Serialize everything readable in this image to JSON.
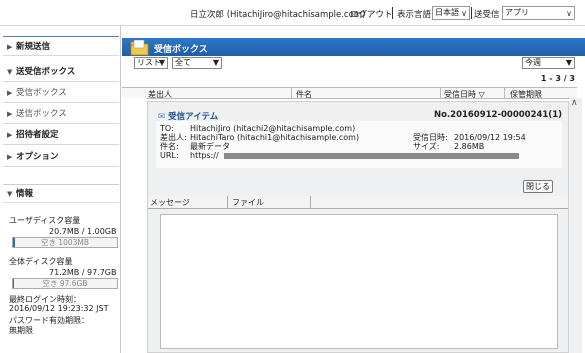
{
  "header": {
    "user": "日立次郎 (HitachiJiro@hitachisample.com)",
    "logout": "ログアウト",
    "language_label": "表示言語",
    "language_value": "日本語",
    "destination_label": "送受信",
    "destination_value": "アプリ"
  },
  "sidebar": {
    "items": [
      {
        "label": "新規送信"
      },
      {
        "label": "送受信ボックス"
      },
      {
        "label": "受信ボックス"
      },
      {
        "label": "送信ボックス"
      },
      {
        "label": "招待者設定"
      },
      {
        "label": "オプション"
      }
    ],
    "info": {
      "title": "情報",
      "user_disk_label": "ユーザディスク容量",
      "user_disk_usage": "20.7MB / 1.00GB",
      "user_disk_free": "空き 1003MB",
      "user_disk_fraction": 0.02,
      "total_disk_label": "全体ディスク容量",
      "total_disk_usage": "71.2MB / 97.7GB",
      "total_disk_free": "空き 97.6GB",
      "total_disk_fraction": 0.01,
      "last_login_label": "最終ログイン時刻：",
      "last_login_value": "2016/09/12 19:23:32 JST",
      "password_expiry_label": "パスワード有効期限：",
      "password_expiry_value": "無期限"
    }
  },
  "main": {
    "title": "受信ボックス",
    "view_select": "リスト",
    "filter_select": "全て",
    "period_select": "今週",
    "count": "1 - 3 / 3",
    "columns": [
      "差出人",
      "件名",
      "受信日時 ▽",
      "保管期限"
    ],
    "detail": {
      "section_title": "受信アイテム",
      "message_no": "No.20160912-00000241(1)",
      "to_label": "TO:",
      "to_value": "HitachiJiro (hitachi2@hitachisample.com)",
      "from_label": "差出人:",
      "from_value": "HitachiTaro (hitachi1@hitachisample.com)",
      "subject_label": "件名:",
      "subject_value": "最新データ",
      "url_label": "URL:",
      "url_value": "https://",
      "received_label": "受信日時:",
      "received_value": "2016/09/12 19:54",
      "size_label": "サイズ:",
      "size_value": "2.86MB",
      "close_button": "閉じる"
    },
    "tabs": [
      "メッセージ",
      "ファイル"
    ]
  },
  "colors": {
    "title_bar": "#2f78c8",
    "accent_text": "#1f4f8f"
  }
}
